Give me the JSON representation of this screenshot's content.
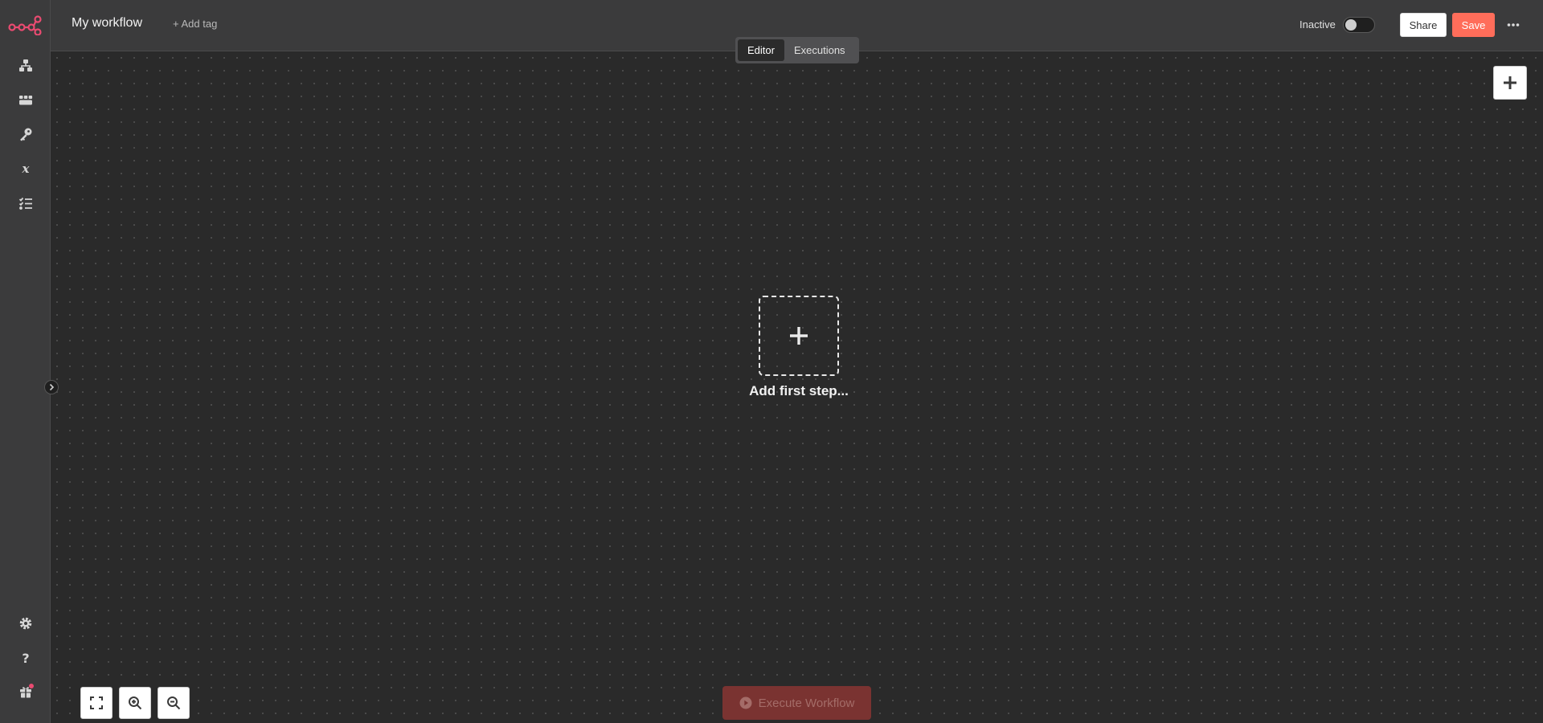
{
  "header": {
    "workflow_name": "My workflow",
    "add_tag_label": "+ Add tag",
    "active_state_label": "Inactive",
    "share_label": "Share",
    "save_label": "Save"
  },
  "tabs": [
    {
      "label": "Editor",
      "active": true
    },
    {
      "label": "Executions",
      "active": false
    }
  ],
  "canvas": {
    "first_step_label": "Add first step..."
  },
  "bottom": {
    "execute_label": "Execute Workflow"
  },
  "sidebar": {
    "items": [
      {
        "icon": "workflows-icon"
      },
      {
        "icon": "templates-icon"
      },
      {
        "icon": "credentials-icon"
      },
      {
        "icon": "variables-icon"
      },
      {
        "icon": "executions-icon"
      }
    ],
    "bottom_items": [
      {
        "icon": "settings-icon"
      },
      {
        "icon": "help-icon"
      },
      {
        "icon": "gift-icon"
      }
    ]
  },
  "colors": {
    "brand": "#ea4b71",
    "save": "#ff6d5a",
    "canvas_bg": "#2a2a2a",
    "chrome_bg": "#3b3b3c"
  }
}
